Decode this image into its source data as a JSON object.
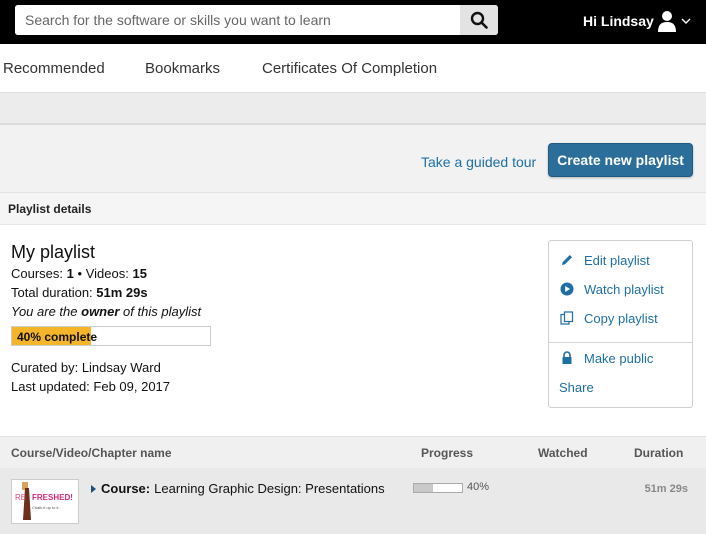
{
  "header": {
    "search_placeholder": "Search for the software or skills you want to learn",
    "greeting": "Hi Lindsay"
  },
  "nav": {
    "tabs": [
      "Recommended",
      "Bookmarks",
      "Certificates Of Completion"
    ]
  },
  "actions": {
    "tour_label": "Take a guided tour",
    "create_label": "Create new playlist"
  },
  "details": {
    "header": "Playlist details",
    "title": "My playlist",
    "courses_label": "Courses:",
    "courses_value": "1",
    "separator": "•",
    "videos_label": "Videos:",
    "videos_value": "15",
    "duration_label": "Total duration:",
    "duration_value": "51m 29s",
    "owner_prefix": "You are the",
    "owner_word": "owner",
    "owner_suffix": "of this playlist",
    "progress_fraction": 0.4,
    "progress_label": "40% complete",
    "curated_by": "Curated by: Lindsay Ward",
    "last_updated": "Last updated: Feb 09, 2017"
  },
  "menu": {
    "edit": "Edit playlist",
    "watch": "Watch playlist",
    "copy": "Copy playlist",
    "make_public": "Make public",
    "share": "Share"
  },
  "table": {
    "columns": [
      "Course/Video/Chapter name",
      "Progress",
      "Watched",
      "Duration"
    ],
    "rows": [
      {
        "type_label": "Course:",
        "name": "Learning Graphic Design: Presentations",
        "progress_fraction": 0.4,
        "progress_text": "40%",
        "watched": "",
        "duration": "51m 29s",
        "thumb_text_1": "RE",
        "thumb_text_2": "FRESHED!",
        "thumb_text_3": "Chalk it up to it."
      }
    ]
  },
  "colors": {
    "topbar": "#000000",
    "accent_blue": "#1d6fa5",
    "button_blue": "#2c6e9a",
    "progress_yellow": "#f5b52a"
  }
}
